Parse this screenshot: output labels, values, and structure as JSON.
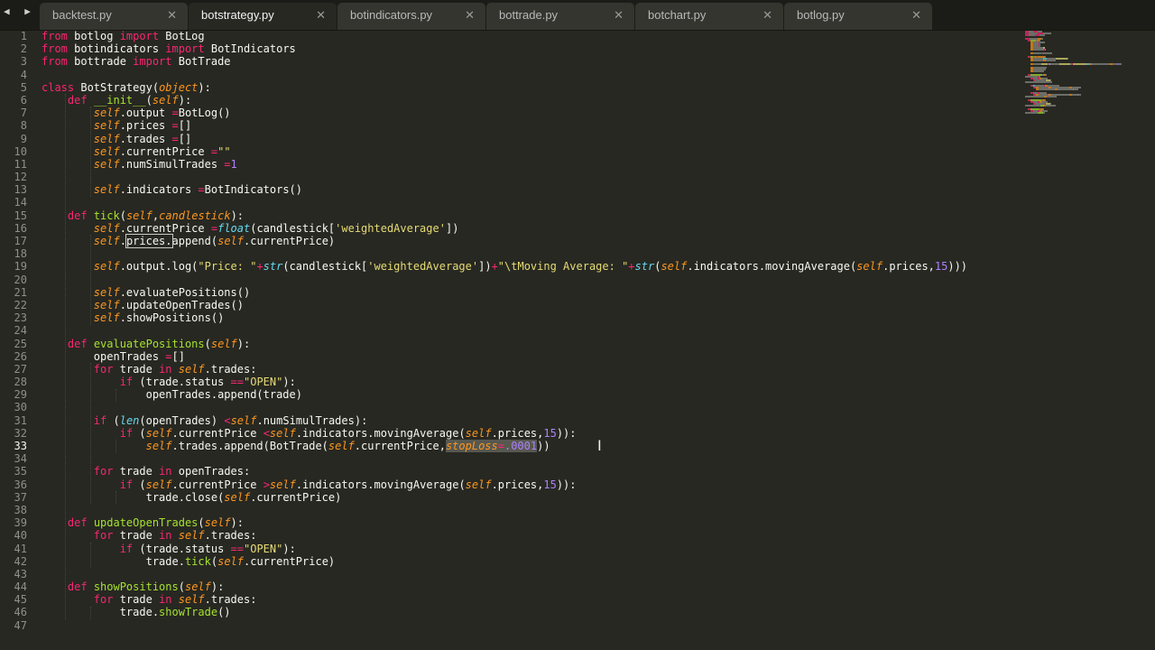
{
  "nav": {
    "arrows": "◀ ▶"
  },
  "tabs": [
    {
      "label": "backtest.py",
      "close": "✕",
      "active": false
    },
    {
      "label": "botstrategy.py",
      "close": "✕",
      "active": true
    },
    {
      "label": "botindicators.py",
      "close": "✕",
      "active": false
    },
    {
      "label": "bottrade.py",
      "close": "✕",
      "active": false
    },
    {
      "label": "botchart.py",
      "close": "✕",
      "active": false
    },
    {
      "label": "botlog.py",
      "close": "✕",
      "active": false
    }
  ],
  "editor": {
    "current_line": 33,
    "lines": [
      [
        [
          "kw",
          "from"
        ],
        [
          "",
          "botlog "
        ],
        [
          "kw",
          "import"
        ],
        [
          "",
          "BotLog"
        ]
      ],
      [
        [
          "kw",
          "from"
        ],
        [
          "",
          "botindicators "
        ],
        [
          "kw",
          "import"
        ],
        [
          "",
          "BotIndicators"
        ]
      ],
      [
        [
          "kw",
          "from"
        ],
        [
          "",
          "bottrade "
        ],
        [
          "kw",
          "import"
        ],
        [
          "",
          "BotTrade"
        ]
      ],
      [],
      [
        [
          "kw",
          "class"
        ],
        [
          "",
          "BotStrategy("
        ],
        [
          "sf",
          "object"
        ],
        [
          "",
          "):"
        ]
      ],
      [
        [
          "",
          "    "
        ],
        [
          "kw",
          "def"
        ],
        [
          "fn",
          "__init__"
        ],
        [
          "",
          "("
        ],
        [
          "sf",
          "self"
        ],
        [
          "",
          "):"
        ]
      ],
      [
        [
          "",
          "        "
        ],
        [
          "sf",
          "self"
        ],
        [
          "",
          ".output "
        ],
        [
          "op",
          "="
        ],
        [
          "",
          "BotLog()"
        ]
      ],
      [
        [
          "",
          "        "
        ],
        [
          "sf",
          "self"
        ],
        [
          "",
          ".prices "
        ],
        [
          "op",
          "="
        ],
        [
          "",
          "[]"
        ]
      ],
      [
        [
          "",
          "        "
        ],
        [
          "sf",
          "self"
        ],
        [
          "",
          ".trades "
        ],
        [
          "op",
          "="
        ],
        [
          "",
          "[]"
        ]
      ],
      [
        [
          "",
          "        "
        ],
        [
          "sf",
          "self"
        ],
        [
          "",
          ".currentPrice "
        ],
        [
          "op",
          "="
        ],
        [
          "str",
          "\"\""
        ]
      ],
      [
        [
          "",
          "        "
        ],
        [
          "sf",
          "self"
        ],
        [
          "",
          ".numSimulTrades "
        ],
        [
          "op",
          "="
        ],
        [
          "num",
          "1"
        ]
      ],
      [],
      [
        [
          "",
          "        "
        ],
        [
          "sf",
          "self"
        ],
        [
          "",
          ".indicators "
        ],
        [
          "op",
          "="
        ],
        [
          "",
          "BotIndicators()"
        ]
      ],
      [],
      [
        [
          "",
          "    "
        ],
        [
          "kw",
          "def"
        ],
        [
          "fn",
          "tick"
        ],
        [
          "",
          "("
        ],
        [
          "sf",
          "self"
        ],
        [
          "",
          ","
        ],
        [
          "sf",
          "candlestick"
        ],
        [
          "",
          "):"
        ]
      ],
      [
        [
          "",
          "        "
        ],
        [
          "sf",
          "self"
        ],
        [
          "",
          ".currentPrice "
        ],
        [
          "op",
          "="
        ],
        [
          "bi",
          "float"
        ],
        [
          "",
          "(candlestick["
        ],
        [
          "str",
          "'weightedAverage'"
        ],
        [
          "",
          "])"
        ]
      ],
      [
        [
          "",
          "        "
        ],
        [
          "sf",
          "self"
        ],
        [
          "",
          "."
        ],
        [
          "boxed",
          "prices."
        ],
        [
          "",
          "append("
        ],
        [
          "sf",
          "self"
        ],
        [
          "",
          ".currentPrice)"
        ]
      ],
      [],
      [
        [
          "",
          "        "
        ],
        [
          "sf",
          "self"
        ],
        [
          "",
          ".output.log("
        ],
        [
          "str",
          "\"Price: \""
        ],
        [
          "op",
          "+"
        ],
        [
          "bi",
          "str"
        ],
        [
          "",
          "(candlestick["
        ],
        [
          "str",
          "'weightedAverage'"
        ],
        [
          "",
          "])"
        ],
        [
          "op",
          "+"
        ],
        [
          "str",
          "\"\\tMoving Average: \""
        ],
        [
          "op",
          "+"
        ],
        [
          "bi",
          "str"
        ],
        [
          "",
          "("
        ],
        [
          "sf",
          "self"
        ],
        [
          "",
          ".indicators.movingAverage("
        ],
        [
          "sf",
          "self"
        ],
        [
          "",
          ".prices,"
        ],
        [
          "num",
          "15"
        ],
        [
          "",
          ")))"
        ]
      ],
      [],
      [
        [
          "",
          "        "
        ],
        [
          "sf",
          "self"
        ],
        [
          "",
          ".evaluatePositions()"
        ]
      ],
      [
        [
          "",
          "        "
        ],
        [
          "sf",
          "self"
        ],
        [
          "",
          ".updateOpenTrades()"
        ]
      ],
      [
        [
          "",
          "        "
        ],
        [
          "sf",
          "self"
        ],
        [
          "",
          ".showPositions()"
        ]
      ],
      [],
      [
        [
          "",
          "    "
        ],
        [
          "kw",
          "def"
        ],
        [
          "fn",
          "evaluatePositions"
        ],
        [
          "",
          "("
        ],
        [
          "sf",
          "self"
        ],
        [
          "",
          "):"
        ]
      ],
      [
        [
          "",
          "        openTrades "
        ],
        [
          "op",
          "="
        ],
        [
          "",
          "[]"
        ]
      ],
      [
        [
          "",
          "        "
        ],
        [
          "kw",
          "for"
        ],
        [
          "",
          "trade "
        ],
        [
          "kw",
          "in"
        ],
        [
          "sf",
          "self"
        ],
        [
          "",
          ".trades:"
        ]
      ],
      [
        [
          "",
          "            "
        ],
        [
          "kw",
          "if"
        ],
        [
          "",
          "(trade.status "
        ],
        [
          "op",
          "=="
        ],
        [
          "str",
          "\"OPEN\""
        ],
        [
          "",
          "):"
        ]
      ],
      [
        [
          "",
          "                openTrades.append(trade)"
        ]
      ],
      [],
      [
        [
          "",
          "        "
        ],
        [
          "kw",
          "if"
        ],
        [
          "",
          "("
        ],
        [
          "bi",
          "len"
        ],
        [
          "",
          "(openTrades) "
        ],
        [
          "op",
          "<"
        ],
        [
          "sf",
          "self"
        ],
        [
          "",
          ".numSimulTrades):"
        ]
      ],
      [
        [
          "",
          "            "
        ],
        [
          "kw",
          "if"
        ],
        [
          "",
          "("
        ],
        [
          "sf",
          "self"
        ],
        [
          "",
          ".currentPrice "
        ],
        [
          "op",
          "<"
        ],
        [
          "sf",
          "self"
        ],
        [
          "",
          ".indicators.movingAverage("
        ],
        [
          "sf",
          "self"
        ],
        [
          "",
          ".prices,"
        ],
        [
          "num",
          "15"
        ],
        [
          "",
          "))"
        ],
        [
          "",
          ":"
        ]
      ],
      [
        [
          "",
          "                "
        ],
        [
          "sf",
          "self"
        ],
        [
          "",
          ".trades.append(BotTrade("
        ],
        [
          "sf",
          "self"
        ],
        [
          "",
          ".currentPrice,"
        ],
        [
          "sfsel",
          "stopLoss"
        ],
        [
          "opsel",
          "="
        ],
        [
          "numsel",
          ".0001"
        ],
        [
          "",
          "))"
        ]
      ],
      [],
      [
        [
          "",
          "        "
        ],
        [
          "kw",
          "for"
        ],
        [
          "",
          "trade "
        ],
        [
          "kw",
          "in"
        ],
        [
          "",
          "openTrades:"
        ]
      ],
      [
        [
          "",
          "            "
        ],
        [
          "kw",
          "if"
        ],
        [
          "",
          "("
        ],
        [
          "sf",
          "self"
        ],
        [
          "",
          ".currentPrice "
        ],
        [
          "op",
          ">"
        ],
        [
          "sf",
          "self"
        ],
        [
          "",
          ".indicators.movingAverage("
        ],
        [
          "sf",
          "self"
        ],
        [
          "",
          ".prices,"
        ],
        [
          "num",
          "15"
        ],
        [
          "",
          ")):"
        ]
      ],
      [
        [
          "",
          "                trade.close("
        ],
        [
          "sf",
          "self"
        ],
        [
          "",
          ".currentPrice)"
        ]
      ],
      [],
      [
        [
          "",
          "    "
        ],
        [
          "kw",
          "def"
        ],
        [
          "fn",
          "updateOpenTrades"
        ],
        [
          "",
          "("
        ],
        [
          "sf",
          "self"
        ],
        [
          "",
          "):"
        ]
      ],
      [
        [
          "",
          "        "
        ],
        [
          "kw",
          "for"
        ],
        [
          "",
          "trade "
        ],
        [
          "kw",
          "in"
        ],
        [
          "sf",
          "self"
        ],
        [
          "",
          ".trades:"
        ]
      ],
      [
        [
          "",
          "            "
        ],
        [
          "kw",
          "if"
        ],
        [
          "",
          "(trade.status "
        ],
        [
          "op",
          "=="
        ],
        [
          "str",
          "\"OPEN\""
        ],
        [
          "",
          "):"
        ]
      ],
      [
        [
          "",
          "                trade."
        ],
        [
          "fn2",
          "tick"
        ],
        [
          "",
          "("
        ],
        [
          "sf",
          "self"
        ],
        [
          "",
          ".currentPrice)"
        ]
      ],
      [],
      [
        [
          "",
          "    "
        ],
        [
          "kw",
          "def"
        ],
        [
          "fn",
          "showPositions"
        ],
        [
          "",
          "("
        ],
        [
          "sf",
          "self"
        ],
        [
          "",
          "):"
        ]
      ],
      [
        [
          "",
          "        "
        ],
        [
          "kw",
          "for"
        ],
        [
          "",
          "trade "
        ],
        [
          "kw",
          "in"
        ],
        [
          "sf",
          "self"
        ],
        [
          "",
          ".trades:"
        ]
      ],
      [
        [
          "",
          "            trade."
        ],
        [
          "fn2",
          "showTrade"
        ],
        [
          "",
          "()"
        ]
      ],
      []
    ]
  },
  "colors": {
    "background": "#272822",
    "keyword": "#f92672",
    "self": "#fd971f",
    "function": "#a6e22e",
    "builtin": "#66d9ef",
    "string": "#e6db74",
    "number": "#ae81ff"
  }
}
